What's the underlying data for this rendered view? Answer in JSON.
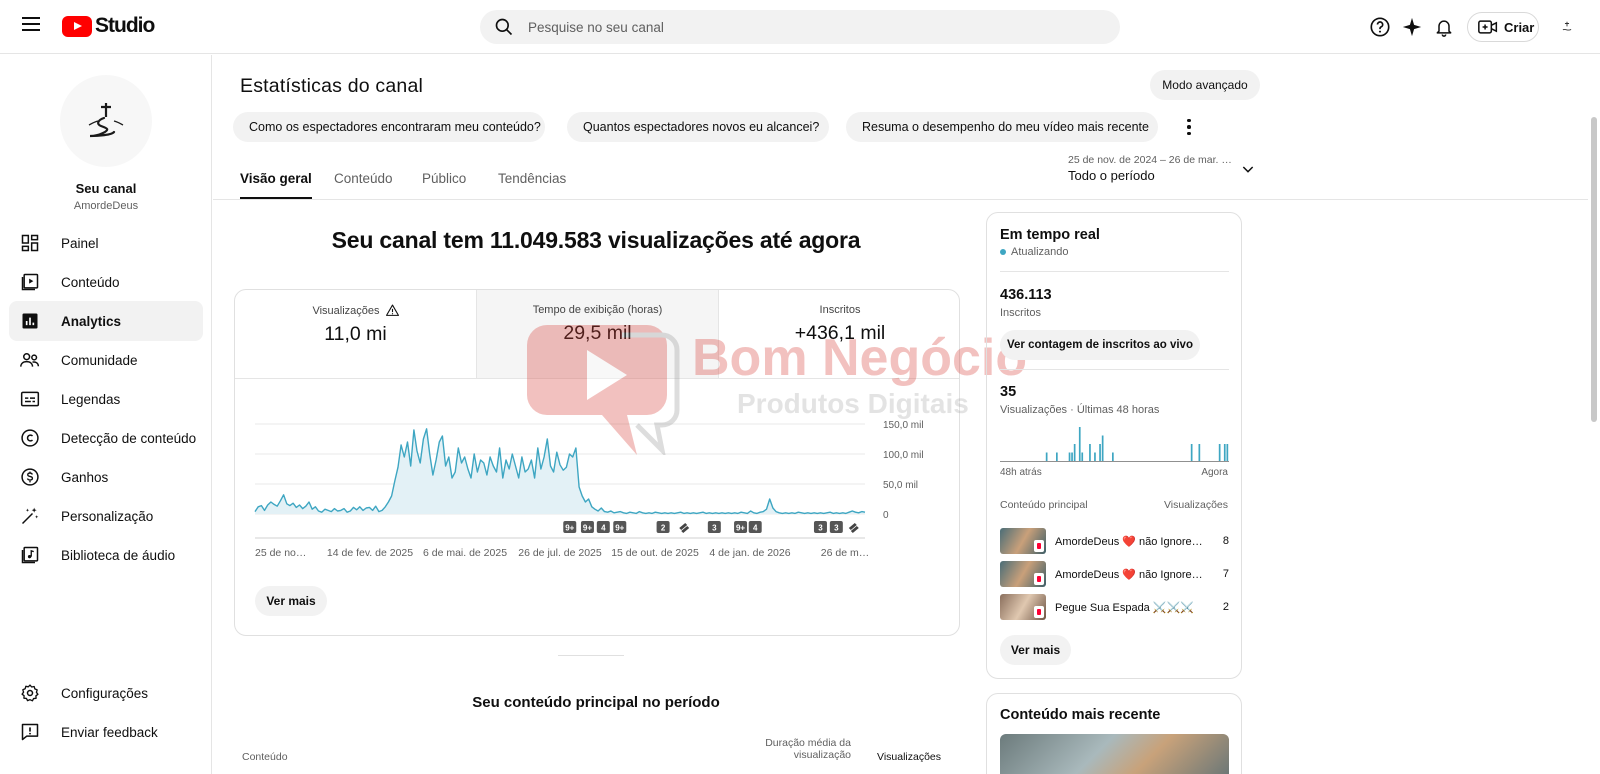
{
  "header": {
    "logo_text": "Studio",
    "search_placeholder": "Pesquise no seu canal",
    "create_label": "Criar"
  },
  "sidebar": {
    "channel_name": "Seu canal",
    "channel_handle": "AmordeDeus",
    "items": [
      {
        "label": "Painel",
        "icon": "dashboard-icon"
      },
      {
        "label": "Conteúdo",
        "icon": "content-icon"
      },
      {
        "label": "Analytics",
        "icon": "analytics-icon",
        "active": true
      },
      {
        "label": "Comunidade",
        "icon": "community-icon"
      },
      {
        "label": "Legendas",
        "icon": "subtitles-icon"
      },
      {
        "label": "Detecção de conteúdo",
        "icon": "copyright-icon"
      },
      {
        "label": "Ganhos",
        "icon": "earn-icon"
      },
      {
        "label": "Personalização",
        "icon": "customization-icon"
      },
      {
        "label": "Biblioteca de áudio",
        "icon": "audio-library-icon"
      }
    ],
    "footer": [
      {
        "label": "Configurações",
        "icon": "settings-icon"
      },
      {
        "label": "Enviar feedback",
        "icon": "feedback-icon"
      }
    ]
  },
  "main": {
    "title": "Estatísticas do canal",
    "advanced_mode": "Modo avançado",
    "chips": [
      "Como os espectadores encontraram meu conteúdo?",
      "Quantos espectadores novos eu alcancei?",
      "Resuma o desempenho do meu vídeo mais recente"
    ],
    "tabs": [
      "Visão geral",
      "Conteúdo",
      "Público",
      "Tendências"
    ],
    "date_range": "25 de nov. de 2024 – 26 de mar. …",
    "period": "Todo o período",
    "headline": "Seu canal tem 11.049.583 visualizações até agora",
    "metrics": [
      {
        "label": "Visualizações",
        "value": "11,0 mi"
      },
      {
        "label": "Tempo de exibição (horas)",
        "value": "29,5 mil"
      },
      {
        "label": "Inscritos",
        "value": "+436,1 mil"
      }
    ],
    "see_more": "Ver mais",
    "top_content_title": "Seu conteúdo principal no período",
    "table_headers": [
      "Conteúdo",
      "Duração média da visualização",
      "Visualizações"
    ]
  },
  "chart_data": {
    "type": "area",
    "y_ticks": [
      "150,0 mil",
      "100,0 mil",
      "50,0 mil",
      "0"
    ],
    "ylim": [
      0,
      150000
    ],
    "x_ticks": [
      "25 de no…",
      "14 de fev. de 2025",
      "6 de mai. de 2025",
      "26 de jul. de 2025",
      "15 de out. de 2025",
      "4 de jan. de 2026",
      "26 de m…"
    ],
    "series": [
      {
        "values": [
          4000,
          12000,
          14000,
          6000,
          15000,
          20000,
          16000,
          13000,
          22000,
          32000,
          17000,
          14000,
          18000,
          11000,
          15000,
          9000,
          13000,
          20000,
          8000,
          12000,
          5000,
          3000,
          8000,
          6000,
          4000,
          9000,
          5000,
          6000,
          9000,
          3000,
          5000,
          11000,
          7000,
          12000,
          6000,
          10000,
          11000,
          6000,
          13000,
          4000,
          6000,
          12000,
          20000,
          30000,
          55000,
          78000,
          115000,
          95000,
          120000,
          80000,
          140000,
          105000,
          85000,
          125000,
          142000,
          100000,
          65000,
          90000,
          120000,
          130000,
          80000,
          95000,
          60000,
          70000,
          110000,
          85000,
          95000,
          75000,
          60000,
          100000,
          70000,
          90000,
          85000,
          65000,
          95000,
          80000,
          70000,
          110000,
          60000,
          90000,
          75000,
          100000,
          80000,
          60000,
          95000,
          70000,
          75000,
          90000,
          60000,
          110000,
          75000,
          95000,
          125000,
          80000,
          70000,
          103000,
          82000,
          73000,
          78000,
          100000,
          95000,
          110000,
          45000,
          30000,
          20000,
          25000,
          12000,
          8000,
          5000,
          10000,
          4000,
          3000,
          5000,
          2000,
          3000,
          4000,
          2000,
          1000,
          3000,
          2000,
          1000,
          4000,
          2000,
          1000,
          2000,
          1000,
          3000,
          2000,
          1000,
          2000,
          1000,
          2000,
          1000,
          2000,
          3000,
          1000,
          2000,
          1000,
          2000,
          1000,
          2000,
          3000,
          1000,
          2000,
          1000,
          2000,
          1000,
          2000,
          1000,
          2000,
          1000,
          2000,
          1000,
          3000,
          2000,
          1000,
          5000,
          2000,
          1000,
          3000,
          4000,
          8000,
          25000,
          10000,
          4000,
          2000,
          1000,
          2000,
          1000,
          2000,
          1000,
          3000,
          2000,
          1000,
          2000,
          1000,
          2000,
          1000,
          2000,
          1000,
          2000,
          3000,
          1000,
          2000,
          1000,
          2000,
          1000,
          3000,
          5000,
          3000,
          2000,
          4000,
          3000
        ]
      }
    ],
    "markers": [
      {
        "label": "9+",
        "pos": 0.516
      },
      {
        "label": "9+",
        "pos": 0.545
      },
      {
        "label": "4",
        "pos": 0.571
      },
      {
        "label": "9+",
        "pos": 0.598
      },
      {
        "label": "2",
        "pos": 0.669
      },
      {
        "label": "",
        "pos": 0.702
      },
      {
        "label": "3",
        "pos": 0.753
      },
      {
        "label": "9+",
        "pos": 0.796
      },
      {
        "label": "4",
        "pos": 0.82
      },
      {
        "label": "3",
        "pos": 0.927
      },
      {
        "label": "3",
        "pos": 0.953
      },
      {
        "label": "",
        "pos": 0.98
      }
    ]
  },
  "realtime": {
    "title": "Em tempo real",
    "status": "Atualizando",
    "subscribers": "436.113",
    "subscribers_label": "Inscritos",
    "live_count_button": "Ver contagem de inscritos ao vivo",
    "views": "35",
    "views_label": "Visualizações · Últimas 48 horas",
    "axis_start": "48h atrás",
    "axis_end": "Agora",
    "bars": [
      0,
      0,
      0,
      0,
      0,
      0,
      0,
      0,
      0,
      0,
      0,
      0,
      0,
      0,
      0,
      0,
      0,
      0,
      1,
      0,
      0,
      0,
      1,
      0,
      0,
      0,
      0,
      1,
      1,
      2,
      0,
      4,
      1,
      0,
      0,
      2,
      0,
      1,
      0,
      2,
      3,
      0,
      0,
      0,
      1,
      0,
      0,
      0,
      0,
      0,
      0,
      0,
      0,
      0,
      0,
      0,
      0,
      0,
      0,
      0,
      0,
      0,
      0,
      0,
      0,
      0,
      0,
      0,
      0,
      0,
      0,
      0,
      0,
      0,
      0,
      2,
      0,
      0,
      2,
      0,
      0,
      0,
      0,
      0,
      0,
      0,
      2,
      0,
      2,
      2
    ],
    "table_headers": [
      "Conteúdo principal",
      "Visualizações"
    ],
    "rows": [
      {
        "title": "AmordeDeus ❤️ não Ignore J…",
        "views": "8"
      },
      {
        "title": "AmordeDeus ❤️ não Ignore J…",
        "views": "7"
      },
      {
        "title": "Pegue Sua Espada ⚔️⚔️⚔️",
        "views": "2"
      }
    ],
    "see_more": "Ver mais"
  },
  "recent": {
    "title": "Conteúdo mais recente"
  },
  "watermark": {
    "line1": "Bom Negócio",
    "line2": "Produtos Digitais"
  },
  "colors": {
    "accent": "#3ea6c2",
    "fill": "#e3f1f6",
    "brand": "#ff0000"
  }
}
